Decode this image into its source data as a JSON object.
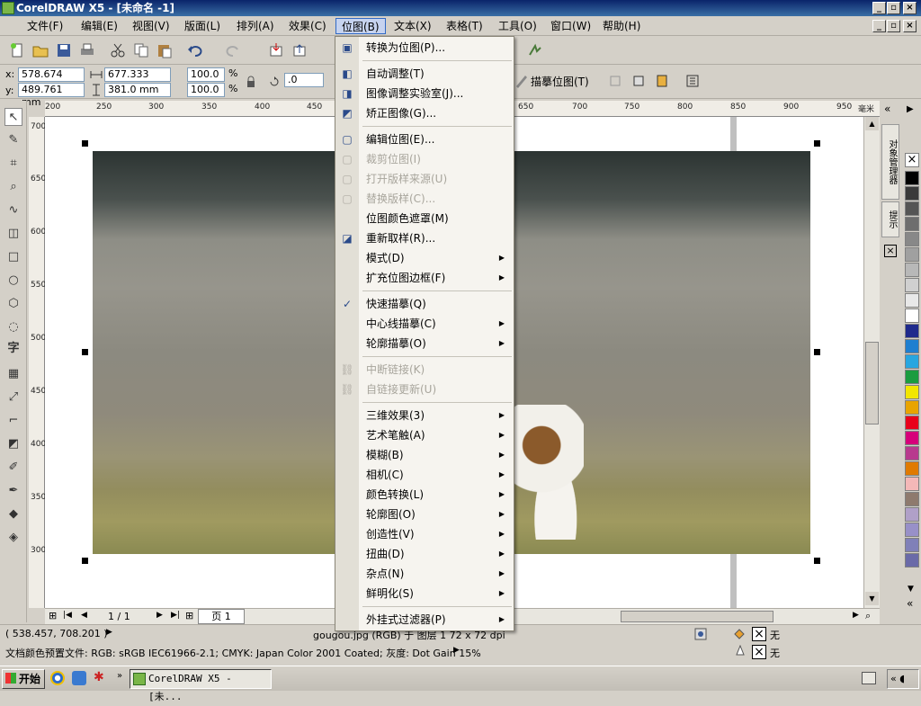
{
  "window": {
    "title": "CorelDRAW X5 - [未命名 -1]"
  },
  "menubar": {
    "items": [
      "文件(F)",
      "编辑(E)",
      "视图(V)",
      "版面(L)",
      "排列(A)",
      "效果(C)",
      "位图(B)",
      "文本(X)",
      "表格(T)",
      "工具(O)",
      "窗口(W)",
      "帮助(H)"
    ],
    "active_index": 6
  },
  "propbar": {
    "x_label": "x:",
    "x_value": "578.674 mm",
    "y_label": "y:",
    "y_value": "489.761 mm",
    "w_value": "677.333 mm",
    "h_value": "381.0 mm",
    "scale_x": "100.0",
    "scale_y": "100.0",
    "percent": "%",
    "angle": ".0",
    "trace_label": "描摹位图(T)"
  },
  "bitmap_menu": {
    "items": [
      {
        "label": "转换为位图(P)...",
        "disabled": false,
        "submenu": false,
        "sep_after": true
      },
      {
        "label": "自动调整(T)",
        "disabled": false,
        "submenu": false
      },
      {
        "label": "图像调整实验室(J)...",
        "disabled": false,
        "submenu": false
      },
      {
        "label": "矫正图像(G)...",
        "disabled": false,
        "submenu": false,
        "sep_after": true
      },
      {
        "label": "编辑位图(E)...",
        "disabled": false,
        "submenu": false
      },
      {
        "label": "裁剪位图(I)",
        "disabled": true,
        "submenu": false
      },
      {
        "label": "打开版样来源(U)",
        "disabled": true,
        "submenu": false
      },
      {
        "label": "替换版样(C)...",
        "disabled": true,
        "submenu": false
      },
      {
        "label": "位图颜色遮罩(M)",
        "disabled": false,
        "submenu": false
      },
      {
        "label": "重新取样(R)...",
        "disabled": false,
        "submenu": false
      },
      {
        "label": "模式(D)",
        "disabled": false,
        "submenu": true
      },
      {
        "label": "扩充位图边框(F)",
        "disabled": false,
        "submenu": true,
        "sep_after": true
      },
      {
        "label": "快速描摹(Q)",
        "disabled": false,
        "submenu": false
      },
      {
        "label": "中心线描摹(C)",
        "disabled": false,
        "submenu": true
      },
      {
        "label": "轮廓描摹(O)",
        "disabled": false,
        "submenu": true,
        "sep_after": true
      },
      {
        "label": "中断链接(K)",
        "disabled": true,
        "submenu": false
      },
      {
        "label": "自链接更新(U)",
        "disabled": true,
        "submenu": false,
        "sep_after": true
      },
      {
        "label": "三维效果(3)",
        "disabled": false,
        "submenu": true
      },
      {
        "label": "艺术笔触(A)",
        "disabled": false,
        "submenu": true
      },
      {
        "label": "模糊(B)",
        "disabled": false,
        "submenu": true
      },
      {
        "label": "相机(C)",
        "disabled": false,
        "submenu": true
      },
      {
        "label": "颜色转换(L)",
        "disabled": false,
        "submenu": true
      },
      {
        "label": "轮廓图(O)",
        "disabled": false,
        "submenu": true
      },
      {
        "label": "创造性(V)",
        "disabled": false,
        "submenu": true
      },
      {
        "label": "扭曲(D)",
        "disabled": false,
        "submenu": true
      },
      {
        "label": "杂点(N)",
        "disabled": false,
        "submenu": true
      },
      {
        "label": "鲜明化(S)",
        "disabled": false,
        "submenu": true,
        "sep_after": true
      },
      {
        "label": "外挂式过滤器(P)",
        "disabled": false,
        "submenu": true
      }
    ]
  },
  "hruler": {
    "ticks": [
      "200",
      "250",
      "300",
      "350",
      "400",
      "450",
      "650",
      "700",
      "750",
      "800",
      "850",
      "900",
      "950"
    ],
    "unit": "毫米"
  },
  "vruler": {
    "ticks": [
      "700",
      "650",
      "600",
      "550",
      "500",
      "450",
      "400",
      "350",
      "300"
    ]
  },
  "page_nav": {
    "count": "1 / 1",
    "tab": "页 1"
  },
  "status": {
    "coords": "( 538.457, 708.201 )",
    "object_info": "gougou.jpg (RGB) 于 图层 1 72 x 72 dpi",
    "fill_label": "无",
    "outline_label": "无",
    "color_profile": "文档颜色预置文件: RGB: sRGB IEC61966-2.1; CMYK: Japan Color 2001 Coated; 灰度: Dot Gain 15%"
  },
  "docker": {
    "tab1": "对象管理器",
    "tab2": "提示"
  },
  "taskbar": {
    "start": "开始",
    "app": "CorelDRAW X5 - [未..."
  },
  "palette": [
    "#000000",
    "#3a3a3a",
    "#555555",
    "#6e6e6e",
    "#888888",
    "#a0a0a0",
    "#b8b8b8",
    "#d0d0d0",
    "#e8e8e8",
    "#ffffff",
    "#1f2a8c",
    "#1f7fd0",
    "#27a6e0",
    "#1a9c3f",
    "#f2e600",
    "#e8a400",
    "#e8001b",
    "#d6007a",
    "#b83a8e",
    "#e07a00",
    "#f4b8b8",
    "#8e7a6e",
    "#b0a0c8",
    "#9890c8",
    "#8080b8",
    "#6a6aa8"
  ],
  "colors": {
    "title_bar": "#0a246a",
    "menu_highlight": "#c6d3ef",
    "chrome": "#d4d0c8"
  }
}
